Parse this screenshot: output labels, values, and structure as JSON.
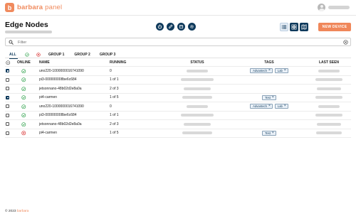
{
  "brand": {
    "logo_letter": "b",
    "name": "barbara",
    "suffix": "panel",
    "color": "#f08a5d"
  },
  "page": {
    "title": "Edge Nodes",
    "new_device_label": "NEW DEVICE"
  },
  "actions": [
    {
      "name": "power-icon"
    },
    {
      "name": "pencil-icon"
    },
    {
      "name": "calendar-icon"
    },
    {
      "name": "gear-icon"
    }
  ],
  "views": [
    {
      "name": "list-view-icon",
      "active": true
    },
    {
      "name": "grid-view-icon",
      "active": false
    },
    {
      "name": "map-view-icon",
      "active": false
    }
  ],
  "filter": {
    "placeholder": "Filter"
  },
  "tabs": {
    "all": "ALL",
    "group1": "GROUP 1",
    "group2": "GROUP 2",
    "group3": "GROUP 3"
  },
  "table": {
    "headers": {
      "online": "ONLINE",
      "name": "NAME",
      "running": "RUNNING",
      "status": "STATUS",
      "tags": "TAGS",
      "last_seen": "LAST SEEN"
    },
    "rows": [
      {
        "checked": true,
        "online": true,
        "name": "uno220-1000000016741090",
        "running": "0",
        "tags": [
          "Advantech",
          "Lab"
        ]
      },
      {
        "checked": false,
        "online": true,
        "name": "pi3-000000008be6c684",
        "running": "1 of 1",
        "tags": []
      },
      {
        "checked": false,
        "online": true,
        "name": "jetsonnano-48b02d2e8a0a",
        "running": "2 of 3",
        "tags": []
      },
      {
        "checked": true,
        "online": true,
        "name": "pi4-carmen",
        "running": "1 of 5",
        "tags": [
          "Test"
        ]
      },
      {
        "checked": false,
        "online": true,
        "name": "uno220-1000000016741090",
        "running": "0",
        "tags": [
          "Advantech",
          "Lab"
        ]
      },
      {
        "checked": false,
        "online": true,
        "name": "pi3-000000008be6c684",
        "running": "1 of 1",
        "tags": []
      },
      {
        "checked": false,
        "online": true,
        "name": "jetsonnano-48b02d2e8a0a",
        "running": "2 of 3",
        "tags": []
      },
      {
        "checked": false,
        "online": false,
        "name": "pi4-carmen",
        "running": "1 of 5",
        "tags": [
          "Test"
        ]
      }
    ]
  },
  "footer": {
    "copyright": "© 2023",
    "brand": "barbara"
  },
  "colors": {
    "primary": "#0f3a5c",
    "accent": "#f0875a",
    "online": "#3aa655",
    "offline": "#d93a3a"
  }
}
